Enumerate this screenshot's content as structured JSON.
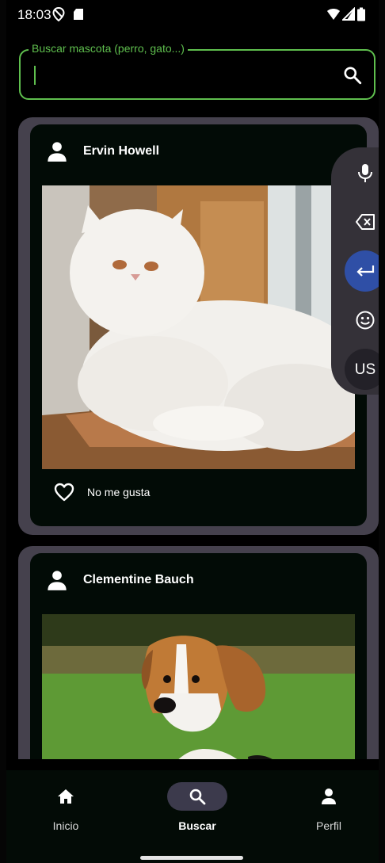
{
  "status_bar": {
    "time": "18:03"
  },
  "search": {
    "label": "Buscar mascota (perro, gato...)",
    "value": ""
  },
  "posts": [
    {
      "user": "Ervin Howell",
      "like_label": "No me gusta",
      "pet": "white persian cat"
    },
    {
      "user": "Clementine Bauch",
      "pet": "beagle puppy"
    }
  ],
  "keyboard_toolbar": {
    "language": "US"
  },
  "nav": {
    "items": [
      {
        "label": "Inicio",
        "icon": "home-icon"
      },
      {
        "label": "Buscar",
        "icon": "search-icon"
      },
      {
        "label": "Perfil",
        "icon": "person-icon"
      }
    ]
  },
  "colors": {
    "accent": "#5fbf4e",
    "card_border": "#45414d",
    "nav_active": "#3c3a4c",
    "keyboard_active": "#2f4fa6"
  }
}
